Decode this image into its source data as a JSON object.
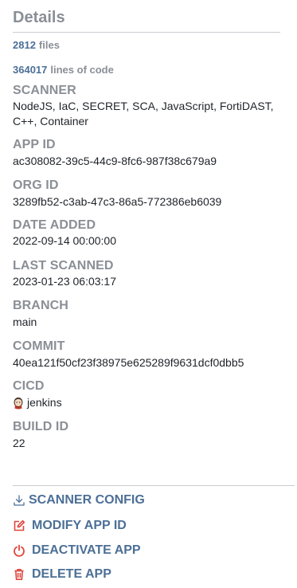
{
  "title": "Details",
  "stats": {
    "files": {
      "value": "2812",
      "unit": "files"
    },
    "lines": {
      "value": "364017",
      "unit": "lines of code"
    }
  },
  "fields": {
    "scanner": {
      "label": "SCANNER",
      "value": "NodeJS, IaC, SECRET, SCA, JavaScript, FortiDAST, C++, Container"
    },
    "app_id": {
      "label": "APP ID",
      "value": "ac308082-39c5-44c9-8fc6-987f38c679a9"
    },
    "org_id": {
      "label": "ORG ID",
      "value": "3289fb52-c3ab-47c3-86a5-772386eb6039"
    },
    "date_added": {
      "label": "DATE ADDED",
      "value": "2022-09-14 00:00:00"
    },
    "last_scanned": {
      "label": "LAST SCANNED",
      "value": "2023-01-23 06:03:17"
    },
    "branch": {
      "label": "BRANCH",
      "value": "main"
    },
    "commit": {
      "label": "COMMIT",
      "value": "40ea121f50cf23f38975e625289f9631dcf0dbb5"
    },
    "cicd": {
      "label": "CICD",
      "value": "jenkins",
      "icon": "jenkins-icon"
    },
    "build_id": {
      "label": "BUILD ID",
      "value": "22"
    }
  },
  "actions": {
    "scanner_config": {
      "label": "SCANNER CONFIG",
      "icon": "download-icon",
      "color": "#4c6f96"
    },
    "modify_app_id": {
      "label": "MODIFY APP ID",
      "icon": "edit-icon",
      "color": "#e0443a"
    },
    "deactivate_app": {
      "label": "DEACTIVATE APP",
      "icon": "power-icon",
      "color": "#e0443a"
    },
    "delete_app": {
      "label": "DELETE APP",
      "icon": "trash-icon",
      "color": "#e0443a"
    }
  }
}
